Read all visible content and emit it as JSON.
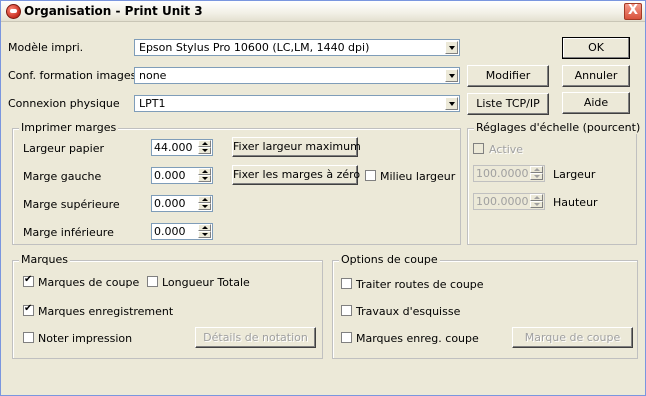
{
  "window": {
    "title": "Organisation - Print Unit 3",
    "close_label": "X"
  },
  "printer": {
    "model_label": "Modèle impri.",
    "model_value": "Epson  Stylus Pro 10600 (LC,LM, 1440 dpi)",
    "conf_label": "Conf. formation images.",
    "conf_value": "none",
    "connection_label": "Connexion physique",
    "connection_value": "LPT1"
  },
  "buttons": {
    "ok": "OK",
    "cancel": "Annuler",
    "help": "Aide",
    "modify": "Modifier",
    "tcpip": "Liste TCP/IP",
    "max_width": "Fixer largeur maximum",
    "zero_margins": "Fixer les marges à zéro",
    "notation_details": "Détails de notation",
    "cut_mark": "Marque de coupe"
  },
  "margins": {
    "legend": "Imprimer marges",
    "paper_width_label": "Largeur papier",
    "paper_width_value": "44.000",
    "left_label": "Marge gauche",
    "left_value": "0.000",
    "top_label": "Marge supérieure",
    "top_value": "0.000",
    "bottom_label": "Marge inférieure",
    "bottom_value": "0.000",
    "center_width_label": "Milieu largeur"
  },
  "scale": {
    "legend": "Réglages d'échelle (pourcent)",
    "active_label": "Active",
    "width_label": "Largeur",
    "width_value": "100.0000",
    "height_label": "Hauteur",
    "height_value": "100.0000"
  },
  "marks": {
    "legend": "Marques",
    "cut_marks_label": "Marques de coupe",
    "total_length_label": "Longueur Totale",
    "registration_label": "Marques enregistrement",
    "note_print_label": "Noter impression"
  },
  "cut_options": {
    "legend": "Options de coupe",
    "cut_routes_label": "Traiter routes de coupe",
    "sketch_label": "Travaux d'esquisse",
    "reg_cut_label": "Marques enreg. coupe"
  }
}
